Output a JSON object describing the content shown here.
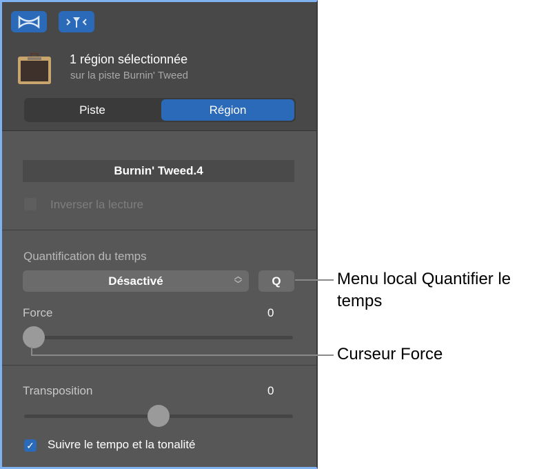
{
  "toolbar": {
    "smart_controls_icon": "bowtie-icon",
    "eq_icon": "tuning-fork-icon"
  },
  "header": {
    "title": "1 région sélectionnée",
    "subtitle": "sur la piste Burnin' Tweed"
  },
  "tabs": [
    {
      "label": "Piste",
      "selected": false
    },
    {
      "label": "Région",
      "selected": true
    }
  ],
  "region": {
    "name": "Burnin' Tweed.4",
    "reverse_label": "Inverser la lecture",
    "reverse_checked": false
  },
  "quantize": {
    "label": "Quantification du temps",
    "value": "Désactivé",
    "q_label": "Q"
  },
  "force": {
    "label": "Force",
    "value": "0",
    "fraction": 0
  },
  "transpose": {
    "label": "Transposition",
    "value": "0",
    "fraction": 0.5
  },
  "follow": {
    "label": "Suivre le tempo et la tonalité",
    "checked": true
  },
  "callouts": {
    "quantize_menu": "Menu local Quantifier le temps",
    "force_slider": "Curseur Force"
  },
  "colors": {
    "accent": "#2a6ab8",
    "panel": "#575757"
  }
}
